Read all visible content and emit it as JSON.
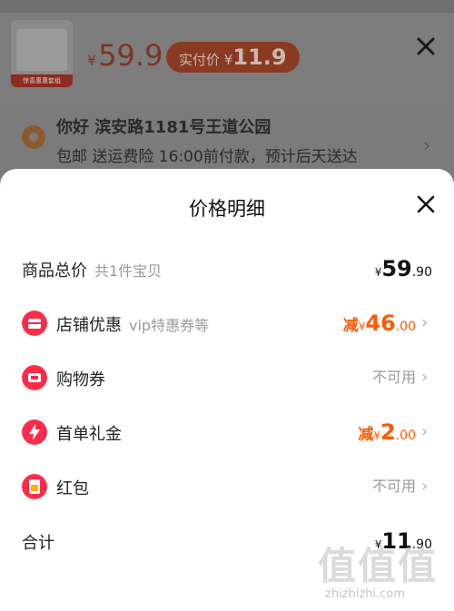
{
  "background": {
    "thumb_caption": "惊喜惠惠套组",
    "price": {
      "currency": "¥",
      "value": "59.9"
    },
    "actual_pay": {
      "label": "实付价",
      "currency": "¥",
      "value": "11.9"
    },
    "address": {
      "line1": "你好 滨安路1181号王道公园",
      "line2": "包邮 送运费险 16:00前付款，预计后天送达"
    }
  },
  "sheet": {
    "title": "价格明细",
    "rows": [
      {
        "label": "商品总价",
        "sub": "共1件宝贝",
        "currency": "¥",
        "int": "59",
        "dec": ".90"
      },
      {
        "label": "店铺优惠",
        "sub": "vip特惠券等",
        "prefix": "减",
        "currency": "¥",
        "int": "46",
        "dec": ".00"
      },
      {
        "label": "购物券",
        "status": "不可用"
      },
      {
        "label": "首单礼金",
        "prefix": "减",
        "currency": "¥",
        "int": "2",
        "dec": ".00"
      },
      {
        "label": "红包",
        "status": "不可用"
      },
      {
        "label": "合计",
        "currency": "¥",
        "int": "11",
        "dec": ".90"
      }
    ]
  },
  "watermark": {
    "logo": "值值值",
    "site": "zhizhizhi.com"
  },
  "colors": {
    "accent": "#ff5a00",
    "icon_red": "#ff2a4a",
    "muted": "#9a9a9a"
  }
}
